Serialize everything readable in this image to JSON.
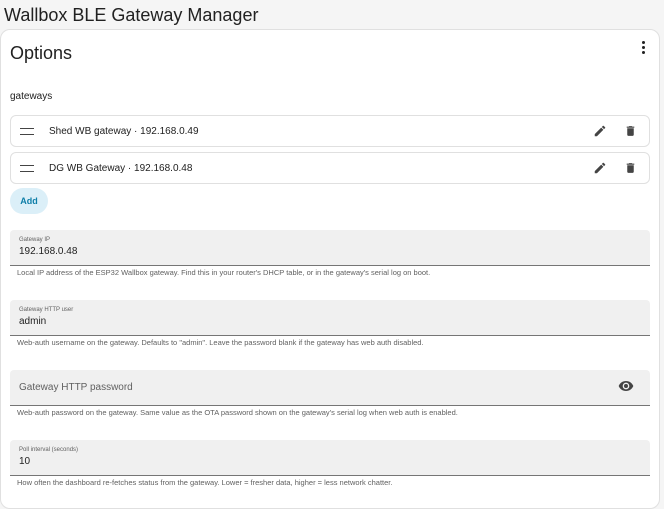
{
  "app": {
    "title": "Wallbox BLE Gateway Manager"
  },
  "card": {
    "title": "Options",
    "menu_icon": "dots-vertical-icon"
  },
  "gateways": {
    "label": "gateways",
    "items": [
      {
        "label": "Shed WB gateway · 192.168.0.49"
      },
      {
        "label": "DG WB Gateway · 192.168.0.48"
      }
    ],
    "add_label": "Add",
    "edit_icon": "pencil-icon",
    "delete_icon": "trash-icon",
    "drag_icon": "drag-handle-icon"
  },
  "fields": {
    "gateway_ip": {
      "label": "Gateway IP",
      "value": "192.168.0.48",
      "helper": "Local IP address of the ESP32 Wallbox gateway. Find this in your router's DHCP table, or in the gateway's serial log on boot."
    },
    "http_user": {
      "label": "Gateway HTTP user",
      "value": "admin",
      "helper": "Web-auth username on the gateway. Defaults to \"admin\". Leave the password blank if the gateway has web auth disabled."
    },
    "http_password": {
      "label": "Gateway HTTP password",
      "value": "",
      "helper": "Web-auth password on the gateway. Same value as the OTA password shown on the gateway's serial log when web auth is enabled.",
      "toggle_icon": "eye-icon"
    },
    "poll_interval": {
      "label": "Poll interval (seconds)",
      "value": "10",
      "helper": "How often the dashboard re-fetches status from the gateway. Lower = fresher data, higher = less network chatter."
    }
  },
  "colors": {
    "accent": "#0e7ea8",
    "accent_bg": "#dbeff8",
    "field_bg": "#f0f0f0"
  }
}
